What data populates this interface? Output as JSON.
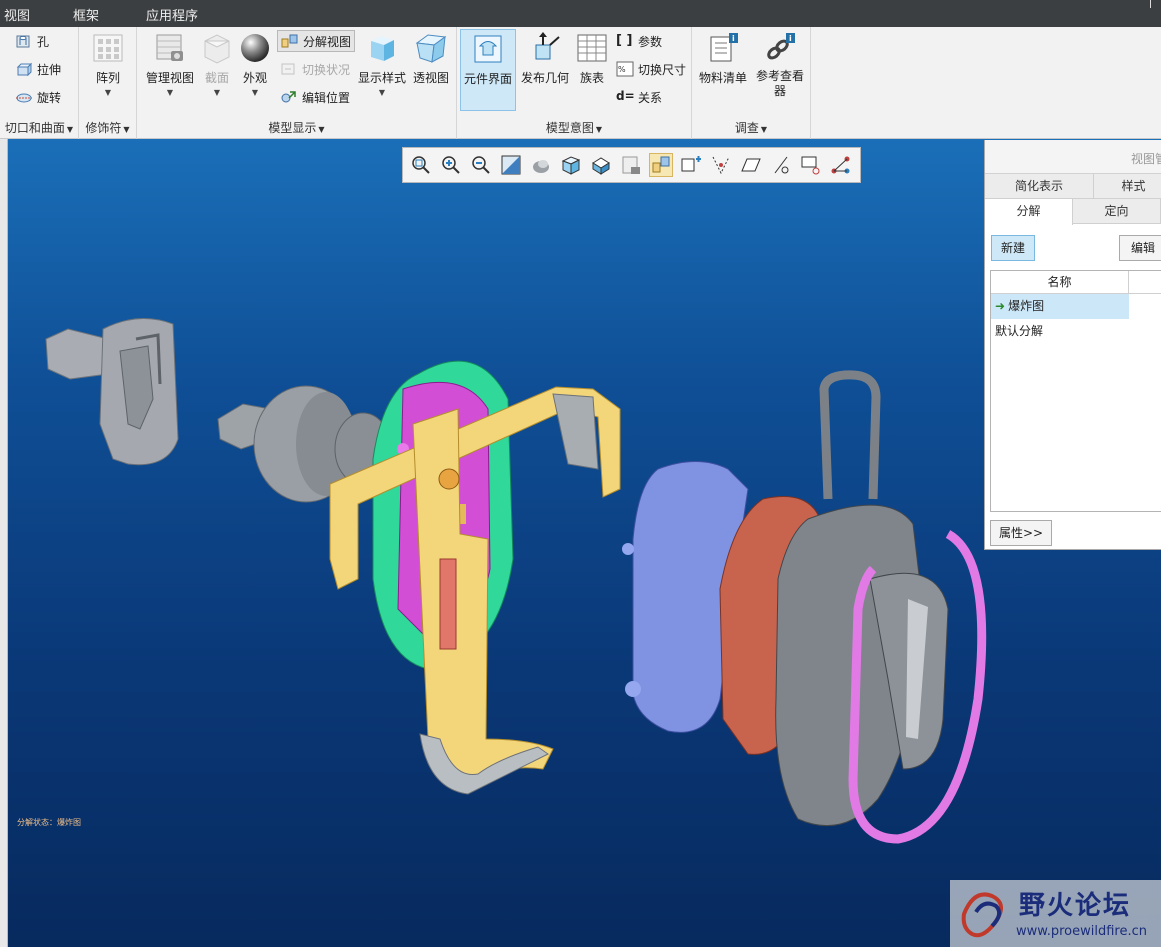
{
  "menubar": {
    "items": [
      "视图",
      "框架",
      "应用程序"
    ]
  },
  "ribbon": {
    "groups": {
      "cut": {
        "label": "切口和曲面",
        "hole": "孔",
        "extrude": "拉伸",
        "revolve": "旋转"
      },
      "modifier": {
        "label": "修饰符",
        "pattern": "阵列"
      },
      "model_display": {
        "label": "模型显示",
        "manage_views": "管理视图",
        "section": "截面",
        "appearance": "外观",
        "explode_view": "分解视图",
        "toggle_status": "切换状况",
        "edit_position": "编辑位置",
        "display_style": "显示样式",
        "perspective": "透视图"
      },
      "model_intent": {
        "label": "模型意图",
        "component_interface": "元件界面",
        "publish_geometry": "发布几何",
        "family_table": "族表",
        "parameters": "参数",
        "switch_dimensions": "切换尺寸",
        "relations": "关系"
      },
      "investigate": {
        "label": "调查",
        "bom": "物料清单",
        "reference_viewer": "参考查看器"
      }
    }
  },
  "viewport": {
    "status_text": "分解状态：爆炸图"
  },
  "view_manager": {
    "title": "视图管",
    "tabs_top": [
      "简化表示",
      "样式"
    ],
    "tabs_bottom": [
      "分解",
      "定向"
    ],
    "new_button": "新建",
    "edit_button": "编辑",
    "column_name": "名称",
    "items": [
      "爆炸图",
      "默认分解"
    ],
    "properties_button": "属性>>"
  },
  "watermark": {
    "title": "野火论坛",
    "url": "www.proewildfire.cn"
  },
  "colors": {
    "menubar": "#3c3f41",
    "ribbon": "#f2f2f2",
    "viewport_top": "#1a6fb8",
    "viewport_bottom": "#072a5e",
    "selection": "#cce7f8",
    "explode_arrow": "#2b8a2b"
  }
}
